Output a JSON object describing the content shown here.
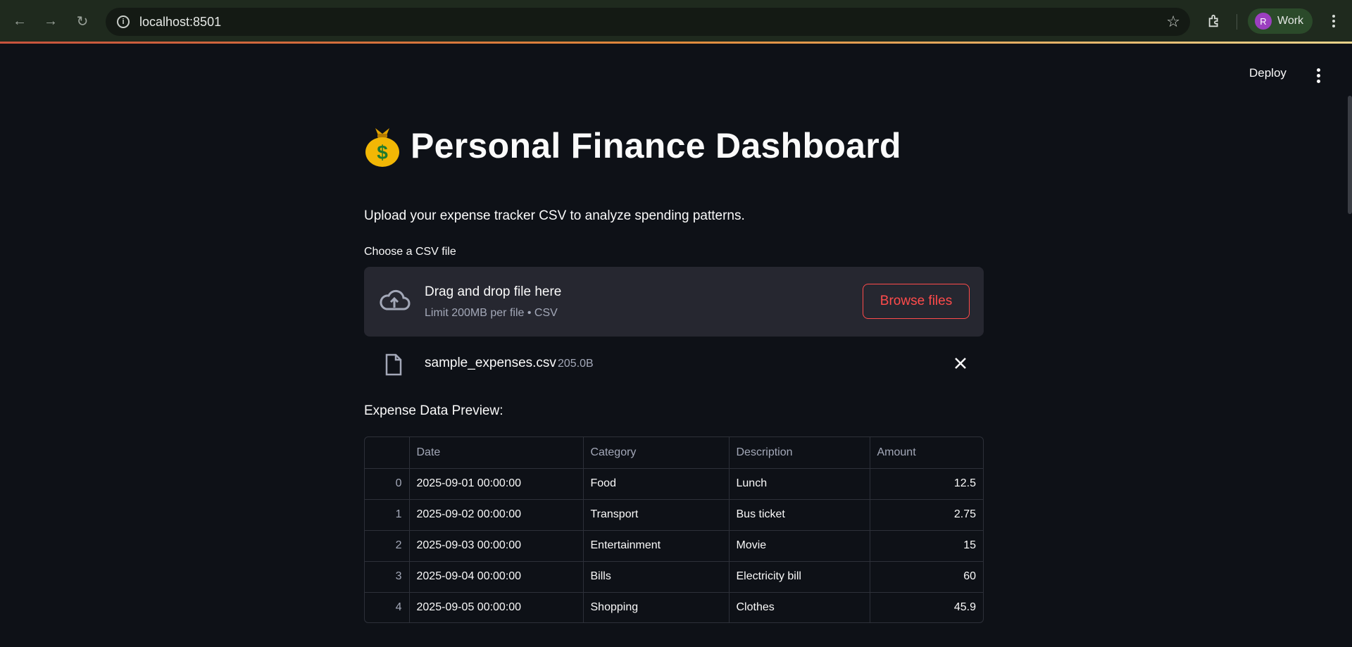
{
  "browser": {
    "url": "localhost:8501",
    "profile_initial": "R",
    "profile_label": "Work"
  },
  "header": {
    "deploy_label": "Deploy"
  },
  "main": {
    "title": "Personal Finance Dashboard",
    "title_icon": "money-bag-emoji",
    "subtitle": "Upload your expense tracker CSV to analyze spending patterns.",
    "upload_label": "Choose a CSV file",
    "dropzone_title": "Drag and drop file here",
    "dropzone_sub": "Limit 200MB per file • CSV",
    "browse_label": "Browse files",
    "file_name": "sample_expenses.csv",
    "file_size": "205.0B",
    "preview_label": "Expense Data Preview:"
  },
  "table": {
    "columns": [
      "",
      "Date",
      "Category",
      "Description",
      "Amount"
    ],
    "rows": [
      [
        "0",
        "2025-09-01 00:00:00",
        "Food",
        "Lunch",
        "12.5"
      ],
      [
        "1",
        "2025-09-02 00:00:00",
        "Transport",
        "Bus ticket",
        "2.75"
      ],
      [
        "2",
        "2025-09-03 00:00:00",
        "Entertainment",
        "Movie",
        "15"
      ],
      [
        "3",
        "2025-09-04 00:00:00",
        "Bills",
        "Electricity bill",
        "60"
      ],
      [
        "4",
        "2025-09-05 00:00:00",
        "Shopping",
        "Clothes",
        "45.9"
      ]
    ]
  },
  "colors": {
    "background": "#0e1117",
    "accent": "#ff4b4b",
    "dropzone_bg": "#262730",
    "muted_text": "#a3a8b8"
  }
}
